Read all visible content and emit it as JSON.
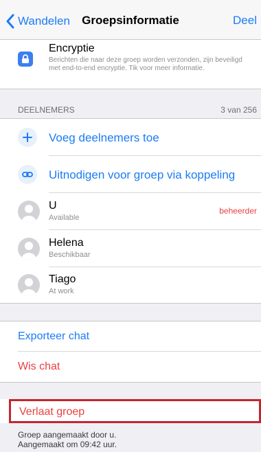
{
  "navbar": {
    "back_label": "Wandelen",
    "title": "Groepsinformatie",
    "share_label": "Deel"
  },
  "encryption": {
    "icon": "lock-icon",
    "title": "Encryptie",
    "description": "Berichten die naar deze groep worden verzonden, zijn beveiligd met end-to-end encryptie. Tik voor meer informatie."
  },
  "participants": {
    "header": "DEELNEMERS",
    "count": "3 van 256",
    "actions": [
      {
        "icon": "plus-icon",
        "label": "Voeg deelnemers toe"
      },
      {
        "icon": "link-icon",
        "label": "Uitnodigen voor groep via koppeling"
      }
    ],
    "members": [
      {
        "name": "U",
        "status": "Available",
        "role": "beheerder"
      },
      {
        "name": "Helena",
        "status": "Beschikbaar",
        "role": ""
      },
      {
        "name": "Tiago",
        "status": "At work",
        "role": ""
      }
    ]
  },
  "chat_actions": {
    "export": "Exporteer chat",
    "clear": "Wis chat"
  },
  "leave_group": "Verlaat groep",
  "footer": {
    "created_by": "Groep aangemaakt door u.",
    "created_at": "Aangemaakt om 09:42 uur."
  },
  "colors": {
    "accent": "#1b7cf5",
    "destructive": "#ea3f3f",
    "highlight_border": "#c4262e"
  }
}
